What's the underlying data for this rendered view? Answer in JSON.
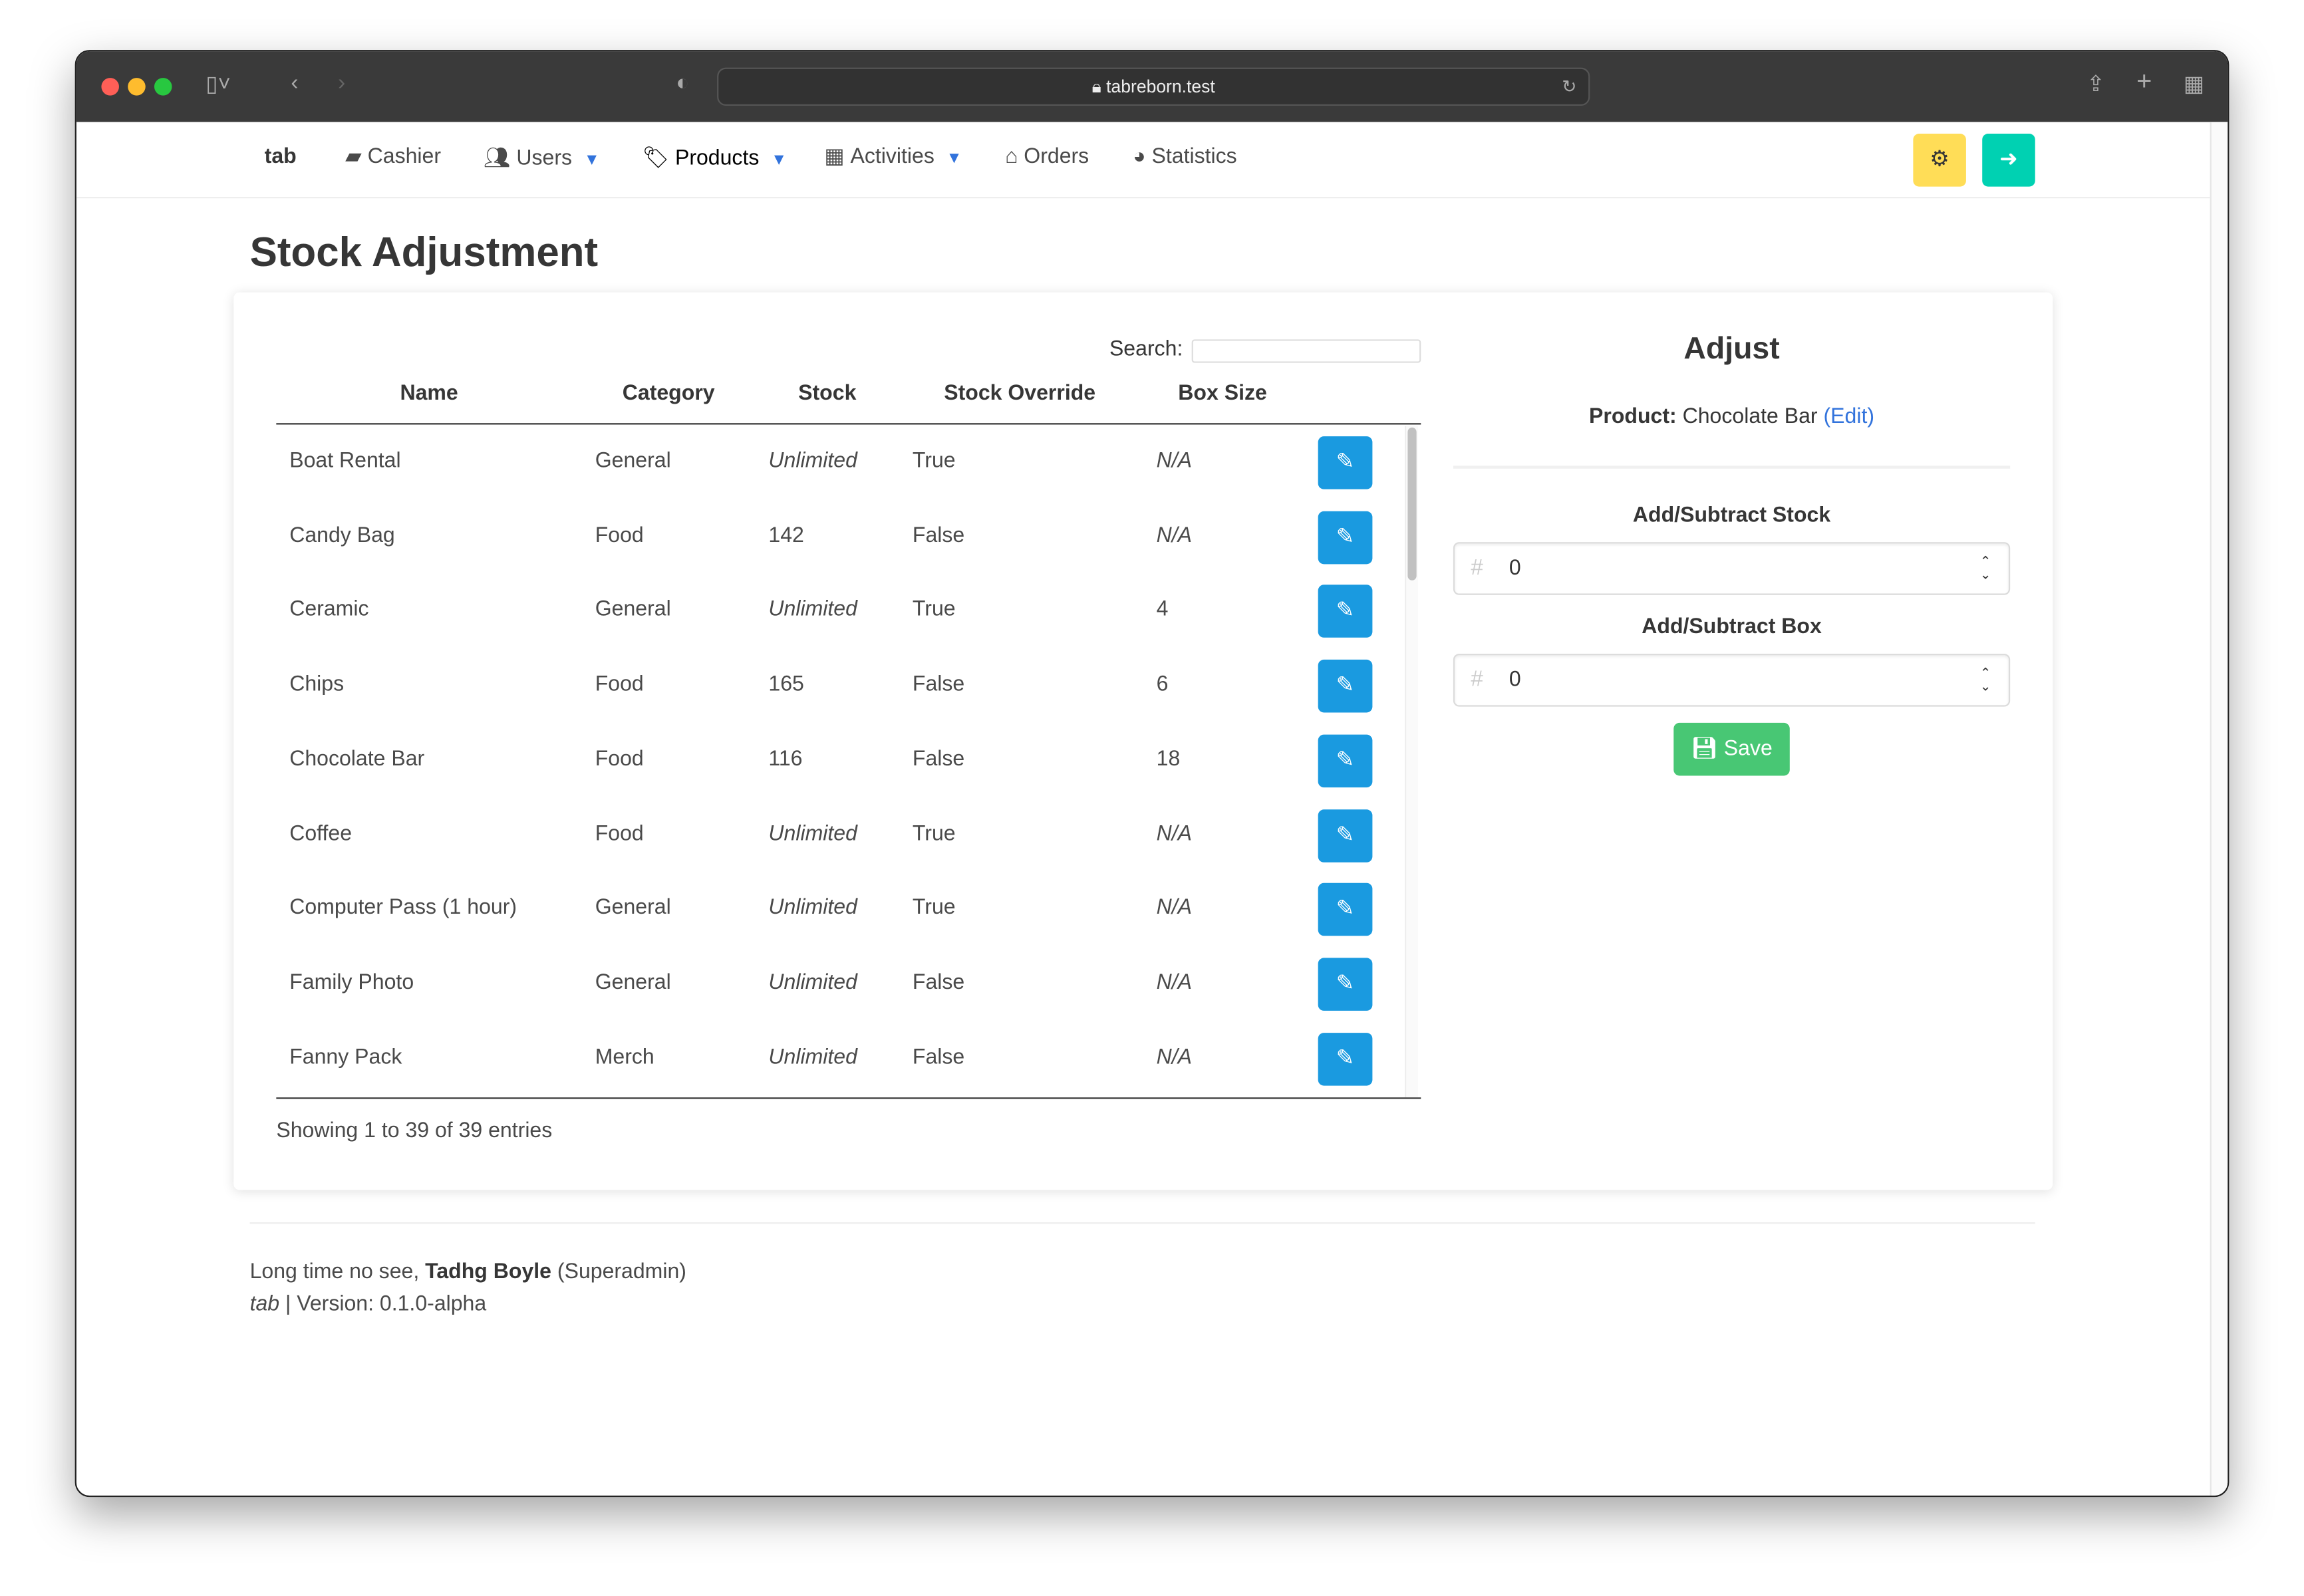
{
  "browser": {
    "url": "tabreborn.test",
    "traffic_lights": [
      "#ff5f57",
      "#febc2e",
      "#28c840"
    ]
  },
  "nav": {
    "brand": "tab",
    "items": [
      {
        "label": "Cashier",
        "icon": "money-icon",
        "dropdown": false
      },
      {
        "label": "Users",
        "icon": "users-icon",
        "dropdown": true
      },
      {
        "label": "Products",
        "icon": "tag-icon",
        "dropdown": true
      },
      {
        "label": "Activities",
        "icon": "calendar-icon",
        "dropdown": true
      },
      {
        "label": "Orders",
        "icon": "basket-icon",
        "dropdown": false
      },
      {
        "label": "Statistics",
        "icon": "pie-chart-icon",
        "dropdown": false
      }
    ],
    "settings_color": "#ffdd57",
    "logout_color": "#00d1b2"
  },
  "page": {
    "title": "Stock Adjustment"
  },
  "table": {
    "search_label": "Search:",
    "search_value": "",
    "columns": [
      "Name",
      "Category",
      "Stock",
      "Stock Override",
      "Box Size"
    ],
    "rows": [
      [
        "Boat Rental",
        "General",
        "Unlimited",
        "True",
        "N/A"
      ],
      [
        "Candy Bag",
        "Food",
        "142",
        "False",
        "N/A"
      ],
      [
        "Ceramic",
        "General",
        "Unlimited",
        "True",
        "4"
      ],
      [
        "Chips",
        "Food",
        "165",
        "False",
        "6"
      ],
      [
        "Chocolate Bar",
        "Food",
        "116",
        "False",
        "18"
      ],
      [
        "Coffee",
        "Food",
        "Unlimited",
        "True",
        "N/A"
      ],
      [
        "Computer Pass (1 hour)",
        "General",
        "Unlimited",
        "True",
        "N/A"
      ],
      [
        "Family Photo",
        "General",
        "Unlimited",
        "False",
        "N/A"
      ],
      [
        "Fanny Pack",
        "Merch",
        "Unlimited",
        "False",
        "N/A"
      ]
    ],
    "info": "Showing 1 to 39 of 39 entries",
    "edit_color": "#1a9ae0"
  },
  "adjust": {
    "title": "Adjust",
    "product_label": "Product:",
    "product_name": "Chocolate Bar",
    "edit_link": "(Edit)",
    "stock_label": "Add/Subtract Stock",
    "stock_value": "0",
    "box_label": "Add/Subtract Box",
    "box_value": "0",
    "hash": "#",
    "save": "Save",
    "save_color": "#48c774"
  },
  "footer": {
    "greeting": "Long time no see,",
    "user": "Tadhg Boyle",
    "role": "(Superadmin)",
    "app": "tab",
    "version": "| Version: 0.1.0-alpha"
  }
}
